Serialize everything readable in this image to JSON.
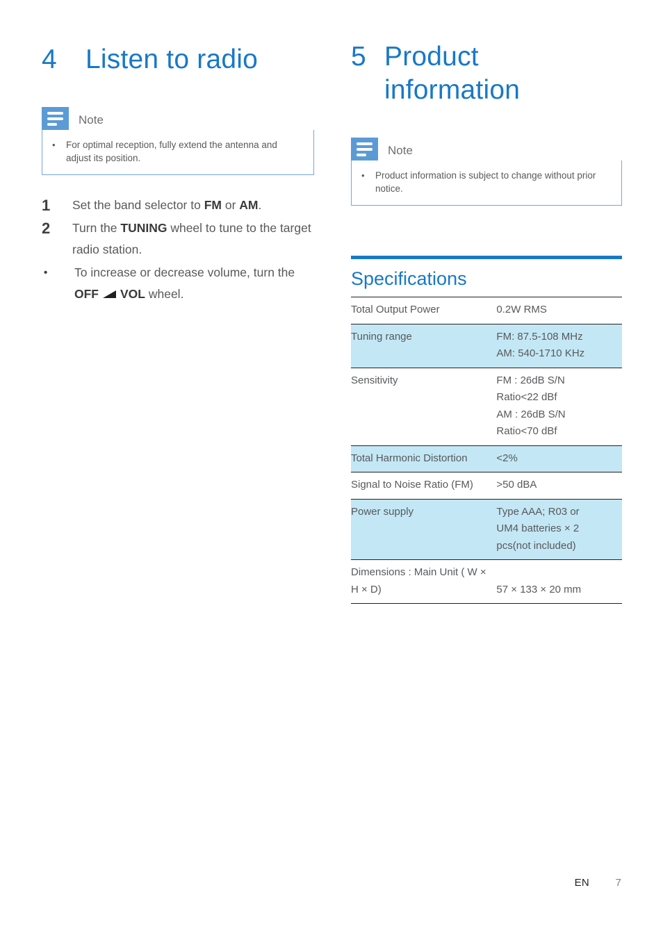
{
  "colors": {
    "heading_blue": "#1878c8",
    "note_icon_blue": "#5b9bd5",
    "note_border_blue": "#6fa8dc",
    "table_tint": "#c3e7f5",
    "body_gray": "#58595b"
  },
  "left_column": {
    "chapter": {
      "number": "4",
      "title": "Listen to radio"
    },
    "note": {
      "label": "Note",
      "bullet": "•",
      "items": [
        "For optimal reception, fully extend the antenna and adjust its position."
      ]
    },
    "steps": [
      {
        "marker": "1",
        "type": "number",
        "parts": [
          {
            "text": "Set the band selector to ",
            "bold": false
          },
          {
            "text": "FM",
            "bold": true
          },
          {
            "text": " or ",
            "bold": false
          },
          {
            "text": "AM",
            "bold": true
          },
          {
            "text": ".",
            "bold": false
          }
        ]
      },
      {
        "marker": "2",
        "type": "number",
        "parts": [
          {
            "text": "Turn the ",
            "bold": false
          },
          {
            "text": "TUNING",
            "bold": true
          },
          {
            "text": " wheel to tune to the target radio station.",
            "bold": false
          }
        ]
      },
      {
        "marker": "•",
        "type": "bullet",
        "parts": [
          {
            "text": "To increase or decrease volume, turn the ",
            "bold": false
          },
          {
            "text": "OFF",
            "bold": true
          },
          {
            "icon": "volume-ramp-icon"
          },
          {
            "text": "VOL",
            "bold": true
          },
          {
            "text": " wheel.",
            "bold": false
          }
        ]
      }
    ]
  },
  "right_column": {
    "chapter": {
      "number": "5",
      "title_line1": "Product",
      "title_line2": "information"
    },
    "note": {
      "label": "Note",
      "bullet": "•",
      "items": [
        "Product information is subject to change without prior notice."
      ]
    },
    "specifications": {
      "title": "Specifications",
      "rows": [
        {
          "key": "Total Output Power",
          "values": [
            "0.2W RMS"
          ],
          "tinted": false
        },
        {
          "key": "Tuning range",
          "values": [
            "FM: 87.5-108 MHz",
            "AM: 540-1710 KHz"
          ],
          "tinted": true
        },
        {
          "key": "Sensitivity",
          "values": [
            "FM : 26dB S/N",
            "Ratio<22 dBf",
            "AM : 26dB S/N",
            "Ratio<70 dBf"
          ],
          "tinted": false
        },
        {
          "key": "Total Harmonic Distortion",
          "values": [
            "<2%"
          ],
          "tinted": true
        },
        {
          "key": "Signal to Noise Ratio (FM)",
          "values": [
            ">50 dBA"
          ],
          "tinted": false
        },
        {
          "key": "Power supply",
          "values": [
            "Type AAA; R03 or",
            "UM4 batteries × 2",
            "pcs(not included)"
          ],
          "tinted": true
        },
        {
          "key": "Dimensions : Main Unit ( W × H × D)",
          "values": [
            "57 × 133 × 20 mm"
          ],
          "tinted": false,
          "value_bottom": true
        }
      ]
    }
  },
  "footer": {
    "language": "EN",
    "page": "7"
  }
}
